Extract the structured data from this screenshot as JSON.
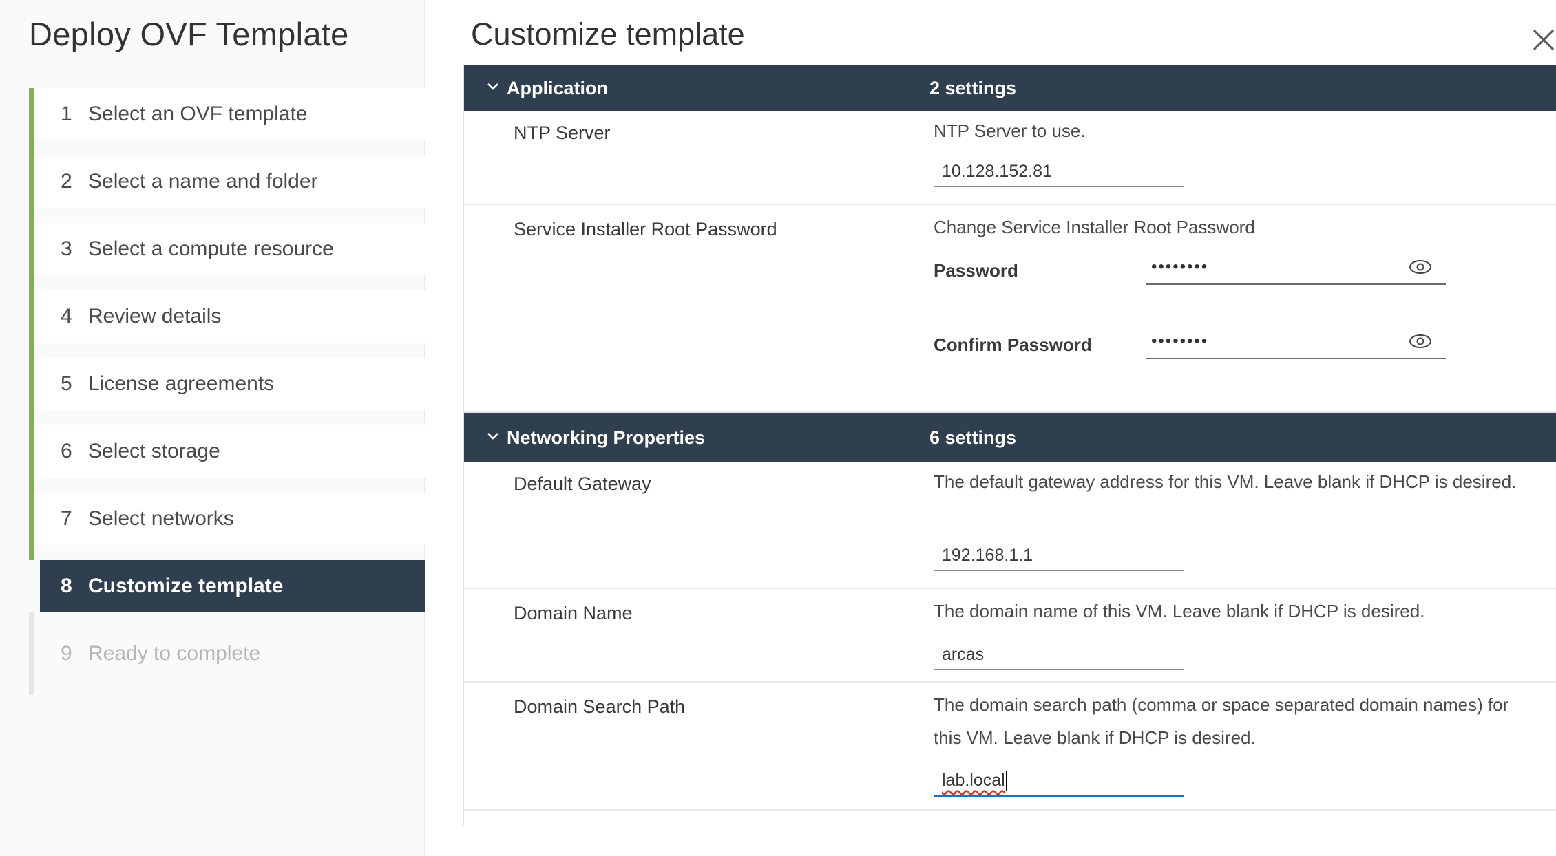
{
  "wizard": {
    "title": "Deploy OVF Template",
    "steps": [
      {
        "num": "1",
        "label": "Select an OVF template"
      },
      {
        "num": "2",
        "label": "Select a name and folder"
      },
      {
        "num": "3",
        "label": "Select a compute resource"
      },
      {
        "num": "4",
        "label": "Review details"
      },
      {
        "num": "5",
        "label": "License agreements"
      },
      {
        "num": "6",
        "label": "Select storage"
      },
      {
        "num": "7",
        "label": "Select networks"
      },
      {
        "num": "8",
        "label": "Customize template"
      },
      {
        "num": "9",
        "label": "Ready to complete"
      }
    ]
  },
  "page": {
    "title": "Customize template",
    "close_icon": "close-icon"
  },
  "groups": {
    "application": {
      "name": "Application",
      "count": "2 settings",
      "ntp": {
        "label": "NTP Server",
        "desc": "NTP Server to use.",
        "value": "10.128.152.81"
      },
      "root_password": {
        "label": "Service Installer Root Password",
        "desc": "Change Service Installer Root Password",
        "password_label": "Password",
        "password_value": "••••••••",
        "confirm_label": "Confirm Password",
        "confirm_value": "••••••••"
      }
    },
    "networking": {
      "name": "Networking Properties",
      "count": "6 settings",
      "gateway": {
        "label": "Default Gateway",
        "desc": "The default gateway address for this VM. Leave blank if DHCP is desired.",
        "value": "192.168.1.1"
      },
      "domain_name": {
        "label": "Domain Name",
        "desc": "The domain name of this VM. Leave blank if DHCP is desired.",
        "value": "arcas"
      },
      "search_path": {
        "label": "Domain Search Path",
        "desc": "The domain search path (comma or space separated domain names) for this VM. Leave blank if DHCP is desired.",
        "value": "lab.local"
      }
    }
  },
  "colors": {
    "header_bg": "#2f3f4f",
    "accent_green": "#7ab648",
    "focus_blue": "#1b72c7"
  }
}
